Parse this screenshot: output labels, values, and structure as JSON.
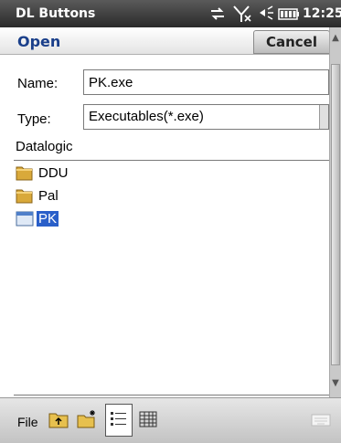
{
  "titlebar": {
    "app_title": "DL Buttons",
    "clock": "12:25",
    "icons": [
      "connectivity-icon",
      "no-signal-icon",
      "volume-icon",
      "battery-icon"
    ]
  },
  "header": {
    "title": "Open",
    "cancel_label": "Cancel"
  },
  "form": {
    "name_label": "Name:",
    "name_value": "PK.exe",
    "type_label": "Type:",
    "type_value": "Executables(*.exe)"
  },
  "folder": {
    "path": "Datalogic"
  },
  "files": [
    {
      "name": "DDU",
      "kind": "folder",
      "selected": false
    },
    {
      "name": "Pal",
      "kind": "folder",
      "selected": false
    },
    {
      "name": "PK",
      "kind": "file",
      "selected": true
    }
  ],
  "toolbar": {
    "file_menu": "File",
    "buttons": [
      "up-folder-icon",
      "new-folder-icon",
      "details-view-icon",
      "list-view-icon"
    ]
  },
  "colors": {
    "title_blue": "#1a3f8a",
    "selection": "#2a5fc9"
  }
}
